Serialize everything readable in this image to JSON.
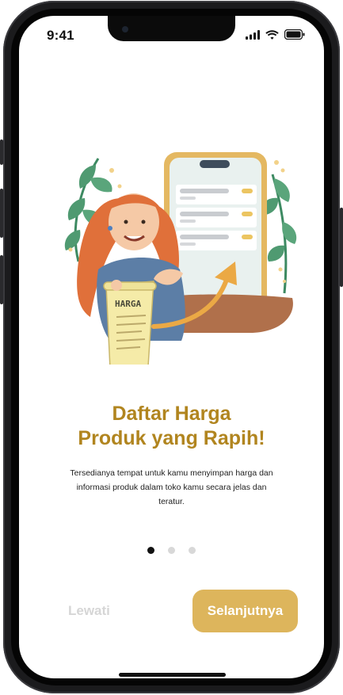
{
  "status": {
    "time": "9:41"
  },
  "illustration": {
    "scroll_label": "HARGA"
  },
  "onboarding": {
    "title_line1": "Daftar Harga",
    "title_line2": "Produk yang Rapih!",
    "description": "Tersedianya tempat untuk kamu menyimpan harga dan informasi produk dalam toko kamu secara jelas dan teratur.",
    "current_page": 1,
    "total_pages": 3
  },
  "actions": {
    "skip_label": "Lewati",
    "next_label": "Selanjutnya"
  },
  "colors": {
    "accent": "#ddb55c",
    "title": "#b1851f",
    "dot_active": "#111111",
    "dot_inactive": "#d8d8d8"
  }
}
